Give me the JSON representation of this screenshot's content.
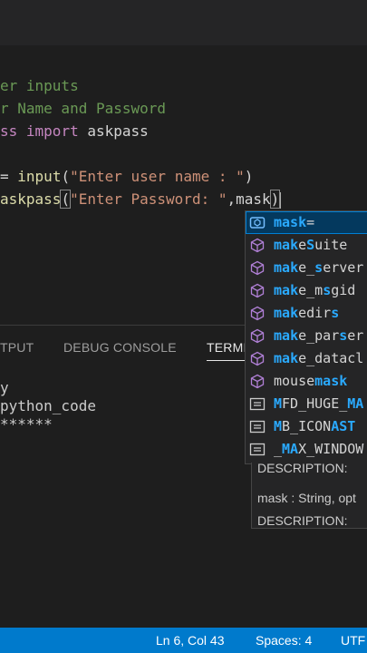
{
  "editor": {
    "comment1_visible": "er inputs",
    "comment2_visible": "r Name and Password",
    "import_kw1_visible": "ss",
    "import_kw2": "import",
    "import_name": "askpass",
    "line4_op": "=",
    "line4_fn": "input",
    "line4_str": "\"Enter user name : \"",
    "line5_fn": "askpass",
    "line5_str": "\"Enter Password: \"",
    "line5_arg": "mask"
  },
  "panel": {
    "tabs": [
      "TPUT",
      "DEBUG CONSOLE",
      "TERMI"
    ]
  },
  "terminal": {
    "lines": [
      "y",
      "python_code",
      "******"
    ]
  },
  "suggestions": [
    {
      "icon": "variable-icon",
      "pre": "",
      "hl": "mask",
      "post": "="
    },
    {
      "icon": "module-icon",
      "parts": [
        "ma",
        "k",
        "e",
        "S",
        "uite"
      ]
    },
    {
      "icon": "module-icon",
      "parts": [
        "ma",
        "k",
        "e_",
        "s",
        "erver"
      ]
    },
    {
      "icon": "module-icon",
      "parts": [
        "ma",
        "k",
        "e_m",
        "s",
        "gid"
      ]
    },
    {
      "icon": "module-icon",
      "parts": [
        "ma",
        "k",
        "edir",
        "s",
        ""
      ]
    },
    {
      "icon": "module-icon",
      "parts": [
        "ma",
        "k",
        "e_par",
        "s",
        "er"
      ]
    },
    {
      "icon": "module-icon",
      "parts": [
        "ma",
        "k",
        "e_datacl",
        "",
        ""
      ]
    },
    {
      "icon": "module-icon",
      "parts": [
        "mouse",
        "mask",
        "",
        "",
        ""
      ]
    },
    {
      "icon": "constant-icon",
      "parts": [
        "M",
        "FD_HUGE_",
        "MA",
        "",
        ""
      ]
    },
    {
      "icon": "constant-icon",
      "parts": [
        "M",
        "B_ICON",
        "AS",
        "T",
        ""
      ]
    },
    {
      "icon": "constant-icon",
      "parts": [
        "_",
        "MA",
        "X_WINDOW",
        "",
        ""
      ]
    }
  ],
  "details": {
    "line1": "DESCRIPTION:",
    "line2": "mask : String, opt",
    "line3": "DESCRIPTION:"
  },
  "statusbar": {
    "position": "Ln 6, Col 43",
    "spaces": "Spaces: 4",
    "encoding": "UTF"
  },
  "colors": {
    "statusbar": "#007acc",
    "highlight": "#2aaaff",
    "selected": "#04395e"
  }
}
